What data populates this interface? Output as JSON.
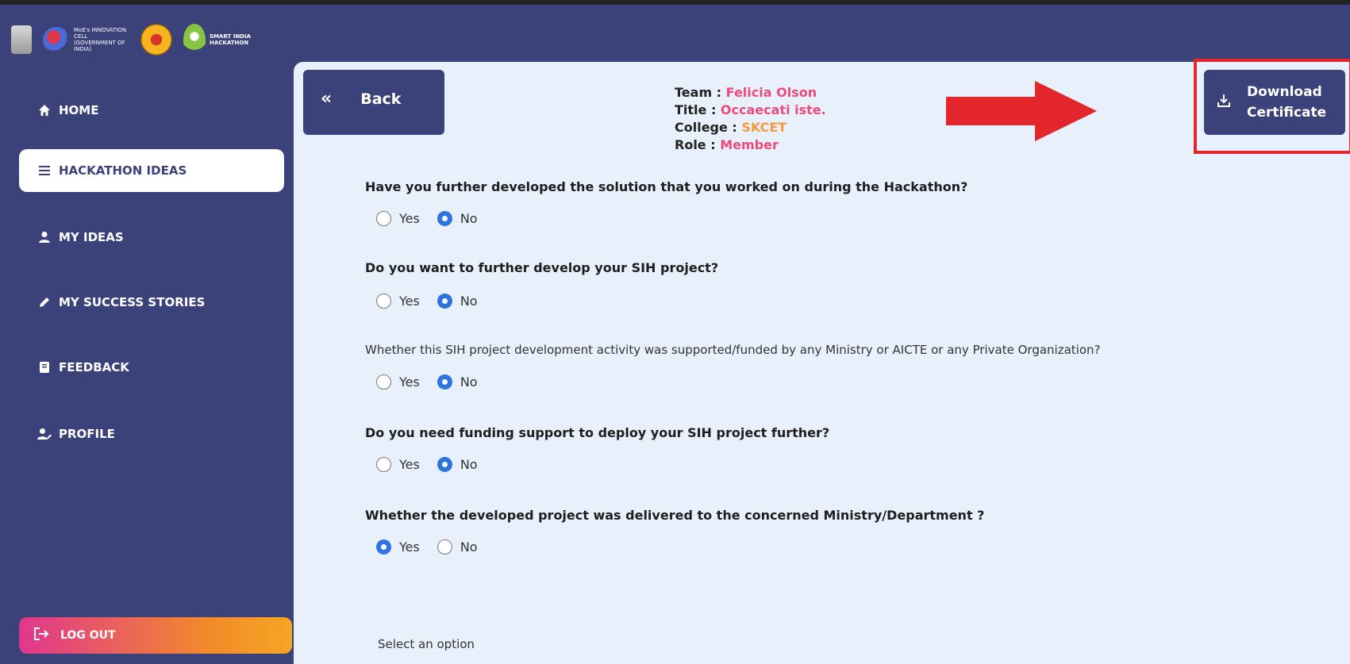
{
  "branding": {
    "moe_text": "MoE's INNOVATION CELL (GOVERNMENT OF INDIA)",
    "sih_text": "SMART INDIA HACKATHON"
  },
  "sidebar": {
    "items": [
      {
        "label": "HOME",
        "icon": "home-icon"
      },
      {
        "label": "HACKATHON IDEAS",
        "icon": "menu-icon",
        "active": true
      },
      {
        "label": "MY IDEAS",
        "icon": "user-icon"
      },
      {
        "label": "MY SUCCESS STORIES",
        "icon": "pencil-icon"
      },
      {
        "label": "FEEDBACK",
        "icon": "book-icon"
      },
      {
        "label": "PROFILE",
        "icon": "user-edit-icon"
      }
    ],
    "logout_label": "LOG OUT"
  },
  "main": {
    "back_label": "Back",
    "info": {
      "team_label": "Team : ",
      "team_value": "Felicia Olson",
      "title_label": "Title : ",
      "title_value": "Occaecati iste.",
      "college_label": "College : ",
      "college_value": "SKCET",
      "role_label": "Role : ",
      "role_value": "Member"
    },
    "download_label_1": "Download",
    "download_label_2": "Certificate",
    "questions": [
      {
        "text": "Have you further developed the solution that you worked on during the Hackathon?",
        "selected": "No"
      },
      {
        "text": "Do you want to further develop your SIH project?",
        "selected": "No"
      },
      {
        "text": "Whether this SIH project development activity was supported/funded by any Ministry or AICTE or any Private Organization?",
        "selected": "No"
      },
      {
        "text": "Do you need funding support to deploy your SIH project further?",
        "selected": "No"
      },
      {
        "text": "Whether the developed project was delivered to the concerned Ministry/Department ?",
        "selected": "Yes"
      }
    ],
    "option_yes": "Yes",
    "option_no": "No",
    "select_placeholder": "Select an option"
  },
  "colors": {
    "brand": "#3b4179",
    "accent_pink": "#ec4a7a",
    "accent_orange": "#f39c3e",
    "radio_on": "#2d74e0",
    "highlight": "#e3262b"
  }
}
